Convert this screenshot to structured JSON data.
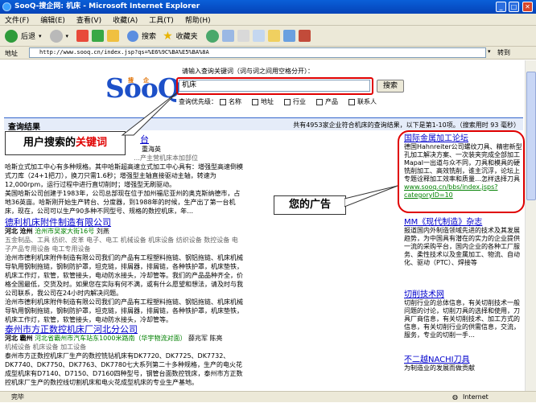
{
  "window": {
    "title": "SooQ-搜企网: 机床 - Microsoft Internet Explorer"
  },
  "menu": [
    "文件(F)",
    "编辑(E)",
    "查看(V)",
    "收藏(A)",
    "工具(T)",
    "帮助(H)"
  ],
  "toolbar": {
    "back": "后退",
    "search": "搜索",
    "favorites": "收藏夹"
  },
  "address": {
    "label": "地址",
    "url": "http://www.sooq.cn/index.jsp?qs=%E6%9C%BA%E5%BA%8A",
    "go": "转到"
  },
  "search": {
    "logo": "SooQ",
    "logo_small": [
      "搜",
      "企"
    ],
    "hint": "请输入查询关键词（词与词之间用空格分开）：",
    "query": "机床",
    "button": "搜索",
    "prefs_label": "查询优先级：",
    "prefs": [
      "名称",
      "地址",
      "行业",
      "产品",
      "联系人"
    ]
  },
  "results_header": {
    "title": "查询结果",
    "summary": "共有4953家企业符合机床的查询结果，以下是第1-10项。（搜索用时 93 毫秒）"
  },
  "callouts": {
    "keyword_prefix": "用户搜索的",
    "keyword_hl": "关键词",
    "ads": "您的广告"
  },
  "results": [
    {
      "title_tail": "台",
      "contact": "重海英",
      "line1": "…产主营机床本加部位",
      "body": "哈斯立式加工中心有多种规格。其中哈斯超高速立式加工中心具有：增强型高速倒模式刀库（24+1把刀），换刀只需1.6秒；增强型主轴直接驱动主轴，转速为12,000rpm，运行过程中进行直切削时；增强型无刷驱动。",
      "body2": "美国哈斯公司创建于1983年，公司总部现在位于加州福尼亚州的奥克斯纳德市，占地36英亩。哈斯刚开始生产转台、分度器，到1988年的时候，生产出了第一台机床，现在，公司可以生产90多种不同型号、规格的数控机床，年…"
    },
    {
      "title": "德利机床附件制造有限公司",
      "province": "河北",
      "city": "沧州",
      "address": "沧州市吴家大街16号",
      "contact": "刘燕",
      "tags": "五金制品、工具 纺织、皮革 电子、电工 机械设备 机床设备 纺织设备 数控设备 电子产品专用设备 电工专用设备",
      "body": "沧州市德利机床附件制造有限公司我们的产品有工程塑料拖链、钢铝拖链、机床机械导轨用钢制拖链，钢制防护罩，坦克链，排屑器，排屑链，各种铁护罩，机床垫铁，机床工作灯，软管，软管接头，电动防水接头，冷却管等。我们的产品品种齐全，价格全国最低，交货及时。如果您在实际有何不满，或有什么愿望和想法，请及时与我公司联系，我公司在24小时内解决问题。",
      "body2": "沧州市德利机床附件制造有限公司我们的产品有工程塑料拖链、钢铝拖链、机床机械导轨用钢制拖链，钢制防护罩，坦克链，排屑器，排屑链，各种铁护罩，机床垫铁，机床工作灯，软管，软管接头，电动防水接头，冷却管等。"
    },
    {
      "title": "泰州市方正数控机床厂河北分公司",
      "province": "河北",
      "city": "霸州",
      "address": "河北省霸州市汽车站东1000米路南（华宇物流对面）",
      "contact": "薛兆军 陈亮",
      "tags": "机械设备 机床设备 加工设备",
      "body": "泰州市方正数控机床厂生产的数控铣钻机床有DK7720、DK7725、DK7732、DK7740、DK7750、DK7763、DK7780七大系列第二十多种规格，生产的电火花成型机床有D7140、D7150、D7160四种型号，钢管台面数控铣床，泰州市方正数控机床厂生产的数控线切割机床和电火花成型机床的专业生产基地。"
    }
  ],
  "ads": [
    {
      "title": "国际金属加工论坛",
      "body": "德国Hahnreiter公司螺纹刀具、精密新型孔加工解决方案、一次装夹完成全部加工Mapal一出道与众不同，刀具和模具的硬铣削加工、高效铣削，谁主沉浮，论坛上专题诠释加工效率和质量…怎样选择刀具",
      "url": "www.sooq.cn/bbs/index.jsps?categoryID=10"
    },
    {
      "title": "MM《现代制造》杂志",
      "body": "报道国内外制造领域先进的技术及其发展趋势，为中国具有潜在的实力的企业提供一流的采购平台，国内企业的各种工厂服务、柔性技术以及金属加工、物流、自动化、驱动（PTC）、焊接等"
    },
    {
      "title": "切削技术网",
      "body": "切削行业的总体信息，有关切削技术一般问题的讨论，切削刀具的选择和使用，刀具厂商信息，有关切削技术、加工方式的信息，有关切削行业的供需信息，交流，服务，专业的切削一手…"
    },
    {
      "title": "不二越NACHI刀具",
      "body": "为制造业的发展而做贡献"
    }
  ],
  "status": {
    "left": "完毕",
    "zone": "Internet"
  }
}
